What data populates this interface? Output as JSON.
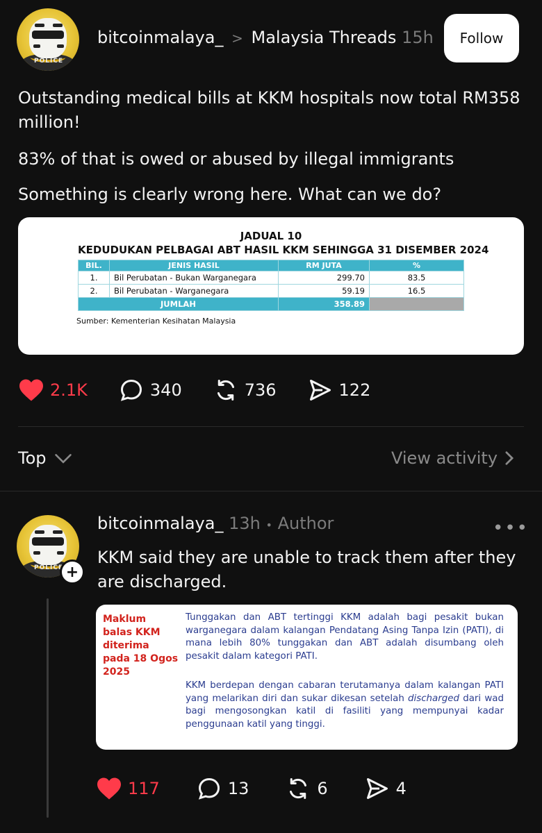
{
  "post": {
    "username": "bitcoinmalaya_",
    "separator": ">",
    "community": "Malaysia Threads",
    "time": "15h",
    "follow_label": "Follow",
    "avatar_text": "POLICE",
    "lines": [
      "Outstanding medical bills at KKM hospitals now total RM358",
      "million!",
      "83% of that is owed or abused by illegal immigrants",
      "Something is clearly wrong here. What can we do?"
    ],
    "table": {
      "title": "JADUAL 10",
      "subtitle": "KEDUDUKAN PELBAGAI ABT HASIL KKM SEHINGGA 31 DISEMBER 2024",
      "headers": [
        "BIL.",
        "JENIS HASIL",
        "RM JUTA",
        "%"
      ],
      "rows": [
        [
          "1.",
          "Bil Perubatan - Bukan Warganegara",
          "299.70",
          "83.5"
        ],
        [
          "2.",
          "Bil Perubatan - Warganegara",
          "59.19",
          "16.5"
        ]
      ],
      "total_label": "JUMLAH",
      "total_value": "358.89",
      "source": "Sumber: Kementerian Kesihatan Malaysia"
    },
    "actions": {
      "likes": "2.1K",
      "comments": "340",
      "reposts": "736",
      "shares": "122"
    }
  },
  "sort": {
    "label": "Top",
    "view_activity": "View activity"
  },
  "reply": {
    "username": "bitcoinmalaya_",
    "time": "13h",
    "bullet": "•",
    "role": "Author",
    "menu": "•••",
    "plus": "+",
    "lines": [
      "KKM said they are unable to track them after they",
      "are discharged."
    ],
    "doc": {
      "side_label": [
        "Maklum",
        "balas KKM",
        "diterima",
        "pada 18 Ogos",
        "2025"
      ],
      "para1": "Tunggakan dan ABT tertinggi KKM adalah bagi pesakit bukan warganegara dalam kalangan Pendatang Asing Tanpa Izin (PATI), di mana lebih 80% tunggakan dan ABT adalah disumbang oleh pesakit dalam kategori PATI.",
      "para2_a": "KKM berdepan dengan cabaran terutamanya dalam kalangan PATI yang melarikan diri dan sukar dikesan setelah ",
      "para2_em": "discharged",
      "para2_b": " dari wad bagi mengosongkan katil di fasiliti yang mempunyai kadar penggunaan katil yang tinggi."
    },
    "actions": {
      "likes": "117",
      "comments": "13",
      "reposts": "6",
      "shares": "4"
    }
  },
  "colors": {
    "background": "#101010",
    "heart": "#ff3b4a",
    "table_header": "#3fb3c9",
    "doc_red": "#d2231d",
    "doc_text": "#2a3c8f"
  }
}
